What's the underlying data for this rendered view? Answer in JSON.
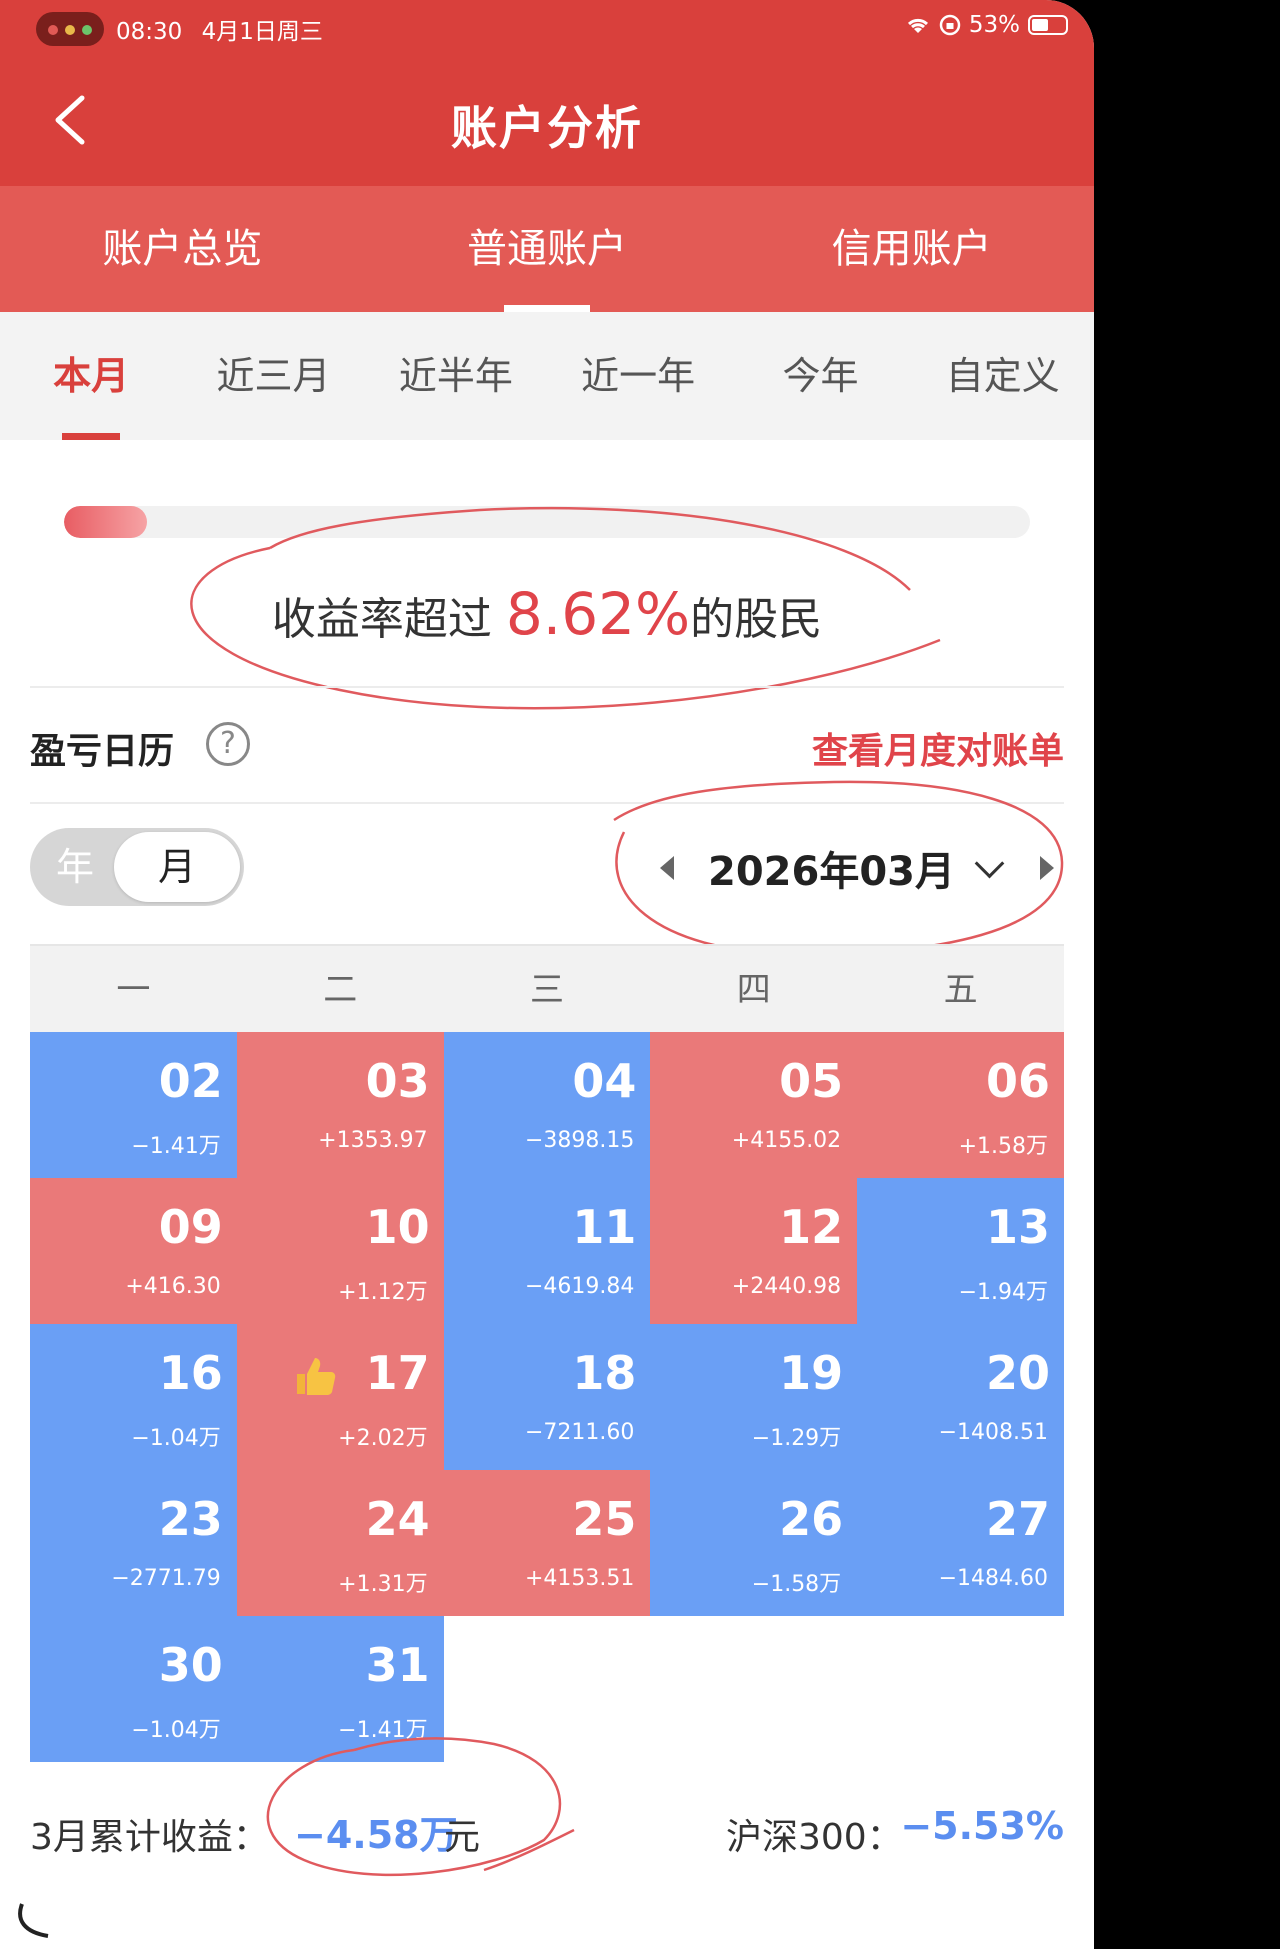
{
  "status_bar": {
    "time": "08:30",
    "date": "4月1日周三",
    "battery": "53%"
  },
  "header": {
    "title": "账户分析"
  },
  "account_tabs": [
    {
      "label": "账户总览"
    },
    {
      "label": "普通账户",
      "active": true
    },
    {
      "label": "信用账户"
    }
  ],
  "period_tabs": [
    {
      "label": "本月",
      "active": true
    },
    {
      "label": "近三月"
    },
    {
      "label": "近半年"
    },
    {
      "label": "近一年"
    },
    {
      "label": "今年"
    },
    {
      "label": "自定义"
    }
  ],
  "percentile": {
    "prefix": "收益率超过 ",
    "value": "8.62%",
    "suffix": "的股民",
    "bar_fraction": 0.0862
  },
  "calendar": {
    "title": "盈亏日历",
    "help": "?",
    "statement_link": "查看月度对账单",
    "toggle_year": "年",
    "toggle_month": "月",
    "month": "2026年03月",
    "weekdays": [
      "一",
      "二",
      "三",
      "四",
      "五"
    ],
    "days": [
      {
        "day": "02",
        "pl": "−1.41万",
        "type": "loss"
      },
      {
        "day": "03",
        "pl": "+1353.97",
        "type": "gain"
      },
      {
        "day": "04",
        "pl": "−3898.15",
        "type": "loss"
      },
      {
        "day": "05",
        "pl": "+4155.02",
        "type": "gain"
      },
      {
        "day": "06",
        "pl": "+1.58万",
        "type": "gain"
      },
      {
        "day": "09",
        "pl": "+416.30",
        "type": "gain"
      },
      {
        "day": "10",
        "pl": "+1.12万",
        "type": "gain"
      },
      {
        "day": "11",
        "pl": "−4619.84",
        "type": "loss"
      },
      {
        "day": "12",
        "pl": "+2440.98",
        "type": "gain"
      },
      {
        "day": "13",
        "pl": "−1.94万",
        "type": "loss"
      },
      {
        "day": "16",
        "pl": "−1.04万",
        "type": "loss"
      },
      {
        "day": "17",
        "pl": "+2.02万",
        "type": "gain",
        "best": true
      },
      {
        "day": "18",
        "pl": "−7211.60",
        "type": "loss"
      },
      {
        "day": "19",
        "pl": "−1.29万",
        "type": "loss"
      },
      {
        "day": "20",
        "pl": "−1408.51",
        "type": "loss"
      },
      {
        "day": "23",
        "pl": "−2771.79",
        "type": "loss"
      },
      {
        "day": "24",
        "pl": "+1.31万",
        "type": "gain"
      },
      {
        "day": "25",
        "pl": "+4153.51",
        "type": "gain"
      },
      {
        "day": "26",
        "pl": "−1.58万",
        "type": "loss"
      },
      {
        "day": "27",
        "pl": "−1484.60",
        "type": "loss"
      },
      {
        "day": "30",
        "pl": "−1.04万",
        "type": "loss"
      },
      {
        "day": "31",
        "pl": "−1.41万",
        "type": "loss"
      },
      {
        "day": "",
        "pl": "",
        "type": "empty"
      },
      {
        "day": "",
        "pl": "",
        "type": "empty"
      },
      {
        "day": "",
        "pl": "",
        "type": "empty"
      }
    ],
    "colors": {
      "gain": "#ea7979",
      "loss": "#6a9ff5"
    }
  },
  "summary": {
    "label": "3月累计收益：",
    "value": "−4.58万",
    "unit": "元",
    "index_label": "沪深300：",
    "index_value": "−5.53%"
  },
  "icons": {
    "back": "back-chevron-icon",
    "help": "question-circle-icon",
    "prev": "triangle-left-icon",
    "dropdown": "chevron-down-icon",
    "next": "triangle-right-icon",
    "best_day": "thumbs-up-icon"
  }
}
